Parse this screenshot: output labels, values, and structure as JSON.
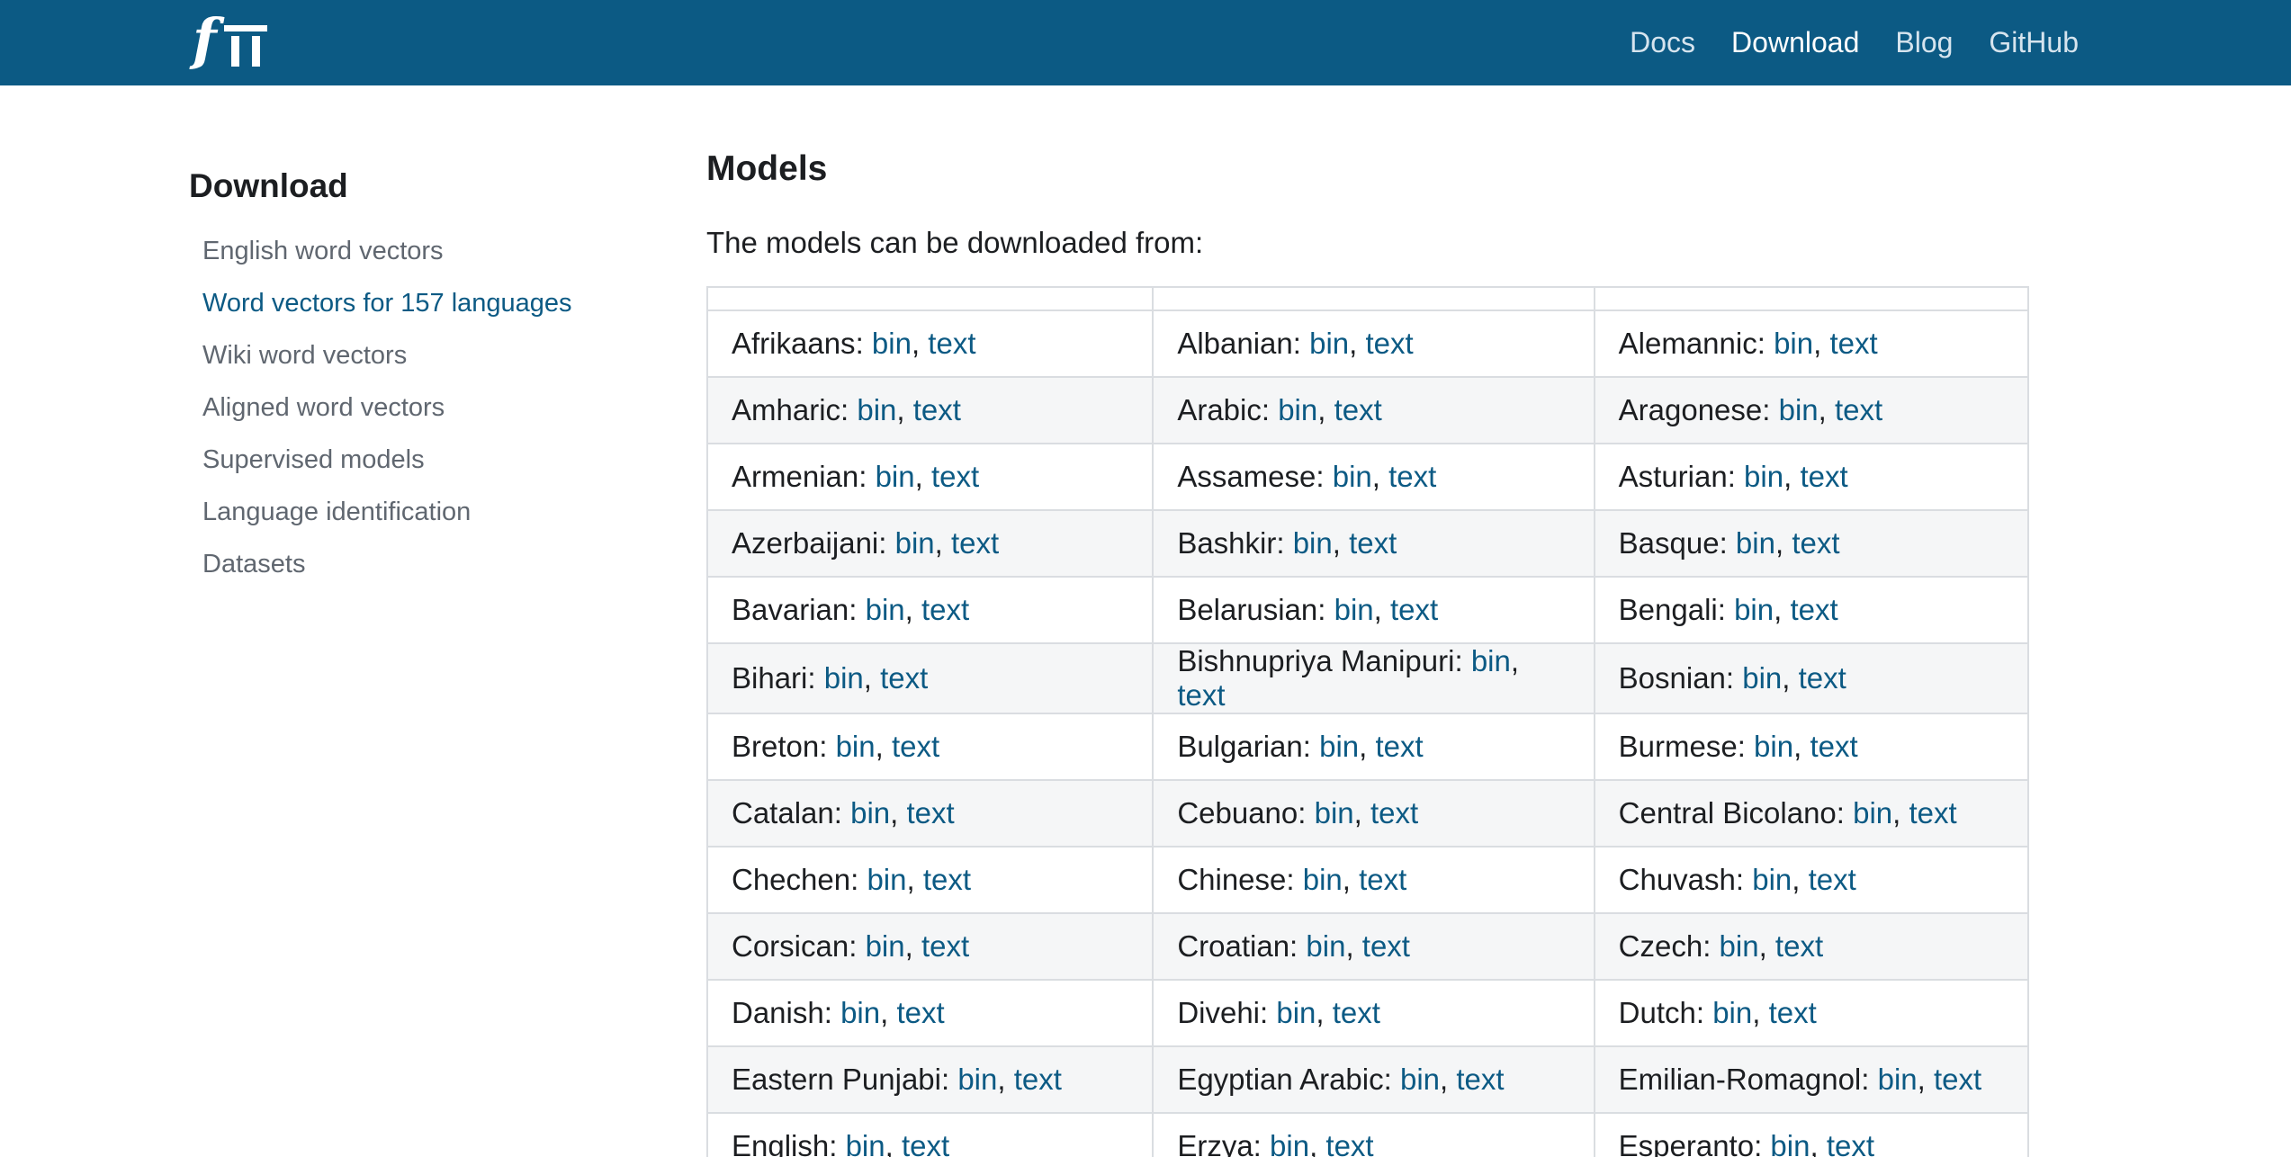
{
  "navbar": {
    "logo_alt": "fastText",
    "links": [
      {
        "label": "Docs",
        "active": false
      },
      {
        "label": "Download",
        "active": true
      },
      {
        "label": "Blog",
        "active": false
      },
      {
        "label": "GitHub",
        "active": false
      }
    ]
  },
  "sidebar": {
    "title": "Download",
    "items": [
      {
        "label": "English word vectors",
        "active": false
      },
      {
        "label": "Word vectors for 157 languages",
        "active": true
      },
      {
        "label": "Wiki word vectors",
        "active": false
      },
      {
        "label": "Aligned word vectors",
        "active": false
      },
      {
        "label": "Supervised models",
        "active": false
      },
      {
        "label": "Language identification",
        "active": false
      },
      {
        "label": "Datasets",
        "active": false
      }
    ]
  },
  "main": {
    "title": "Models",
    "intro": "The models can be downloaded from:",
    "link_bin": "bin",
    "link_text": "text",
    "separator": ", ",
    "rows": [
      [
        "Afrikaans",
        "Albanian",
        "Alemannic"
      ],
      [
        "Amharic",
        "Arabic",
        "Aragonese"
      ],
      [
        "Armenian",
        "Assamese",
        "Asturian"
      ],
      [
        "Azerbaijani",
        "Bashkir",
        "Basque"
      ],
      [
        "Bavarian",
        "Belarusian",
        "Bengali"
      ],
      [
        "Bihari",
        "Bishnupriya Manipuri",
        "Bosnian"
      ],
      [
        "Breton",
        "Bulgarian",
        "Burmese"
      ],
      [
        "Catalan",
        "Cebuano",
        "Central Bicolano"
      ],
      [
        "Chechen",
        "Chinese",
        "Chuvash"
      ],
      [
        "Corsican",
        "Croatian",
        "Czech"
      ],
      [
        "Danish",
        "Divehi",
        "Dutch"
      ],
      [
        "Eastern Punjabi",
        "Egyptian Arabic",
        "Emilian-Romagnol"
      ],
      [
        "English",
        "Erzya",
        "Esperanto"
      ]
    ]
  },
  "colors": {
    "navbar_bg": "#0c5a84",
    "link": "#0c5a84",
    "text": "#1c1e21",
    "muted": "#606770",
    "row_alt": "#f5f6f7",
    "border": "#dadde1"
  }
}
